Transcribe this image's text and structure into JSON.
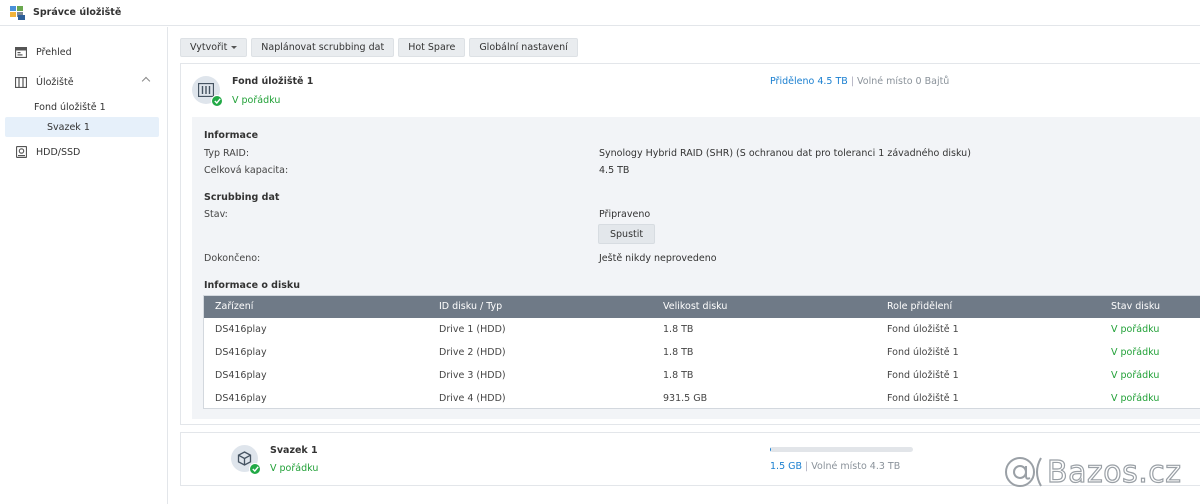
{
  "app": {
    "title": "Správce úložiště"
  },
  "sidebar": {
    "items": [
      {
        "label": "Přehled",
        "icon": "overview-icon"
      },
      {
        "label": "Úložiště",
        "icon": "storage-icon",
        "expanded": true
      },
      {
        "label": "HDD/SSD",
        "icon": "hdd-icon"
      }
    ],
    "subitems": [
      {
        "label": "Fond úložiště 1"
      },
      {
        "label": "Svazek 1",
        "active": true
      }
    ]
  },
  "toolbar": {
    "create_label": "Vytvořit",
    "schedule_label": "Naplánovat scrubbing dat",
    "hotspare_label": "Hot Spare",
    "global_label": "Globální nastavení"
  },
  "pool": {
    "name": "Fond úložiště 1",
    "status": "V pořádku",
    "allocated": "Přiděleno 4.5 TB",
    "separator": "|",
    "free": "Volné místo 0 Bajtů",
    "info": {
      "heading": "Informace",
      "raid_label": "Typ RAID:",
      "raid_value": "Synology Hybrid RAID (SHR) (S ochranou dat pro toleranci 1 závadného disku)",
      "capacity_label": "Celková kapacita:",
      "capacity_value": "4.5 TB"
    },
    "scrubbing": {
      "heading": "Scrubbing dat",
      "state_label": "Stav:",
      "state_value": "Připraveno",
      "run_label": "Spustit",
      "done_label": "Dokončeno:",
      "done_value": "Ještě nikdy neprovedeno"
    },
    "disks": {
      "heading": "Informace o disku",
      "columns": [
        "Zařízení",
        "ID disku / Typ",
        "Velikost disku",
        "Role přidělení",
        "Stav disku"
      ],
      "rows": [
        [
          "DS416play",
          "Drive 1 (HDD)",
          "1.8 TB",
          "Fond úložiště 1",
          "V pořádku"
        ],
        [
          "DS416play",
          "Drive 2 (HDD)",
          "1.8 TB",
          "Fond úložiště 1",
          "V pořádku"
        ],
        [
          "DS416play",
          "Drive 3 (HDD)",
          "1.8 TB",
          "Fond úložiště 1",
          "V pořádku"
        ],
        [
          "DS416play",
          "Drive 4 (HDD)",
          "931.5 GB",
          "Fond úložiště 1",
          "V pořádku"
        ]
      ]
    }
  },
  "volume": {
    "name": "Svazek 1",
    "status": "V pořádku",
    "used": "1.5 GB",
    "separator": "|",
    "free": "Volné místo 4.3 TB",
    "usage_fraction": 0.0003
  },
  "watermark": {
    "text": "Bazos.cz"
  },
  "colors": {
    "accent": "#1a7fd0",
    "ok_green": "#22a138",
    "table_header": "#6f7a87",
    "detail_bg": "#f2f4f7"
  }
}
